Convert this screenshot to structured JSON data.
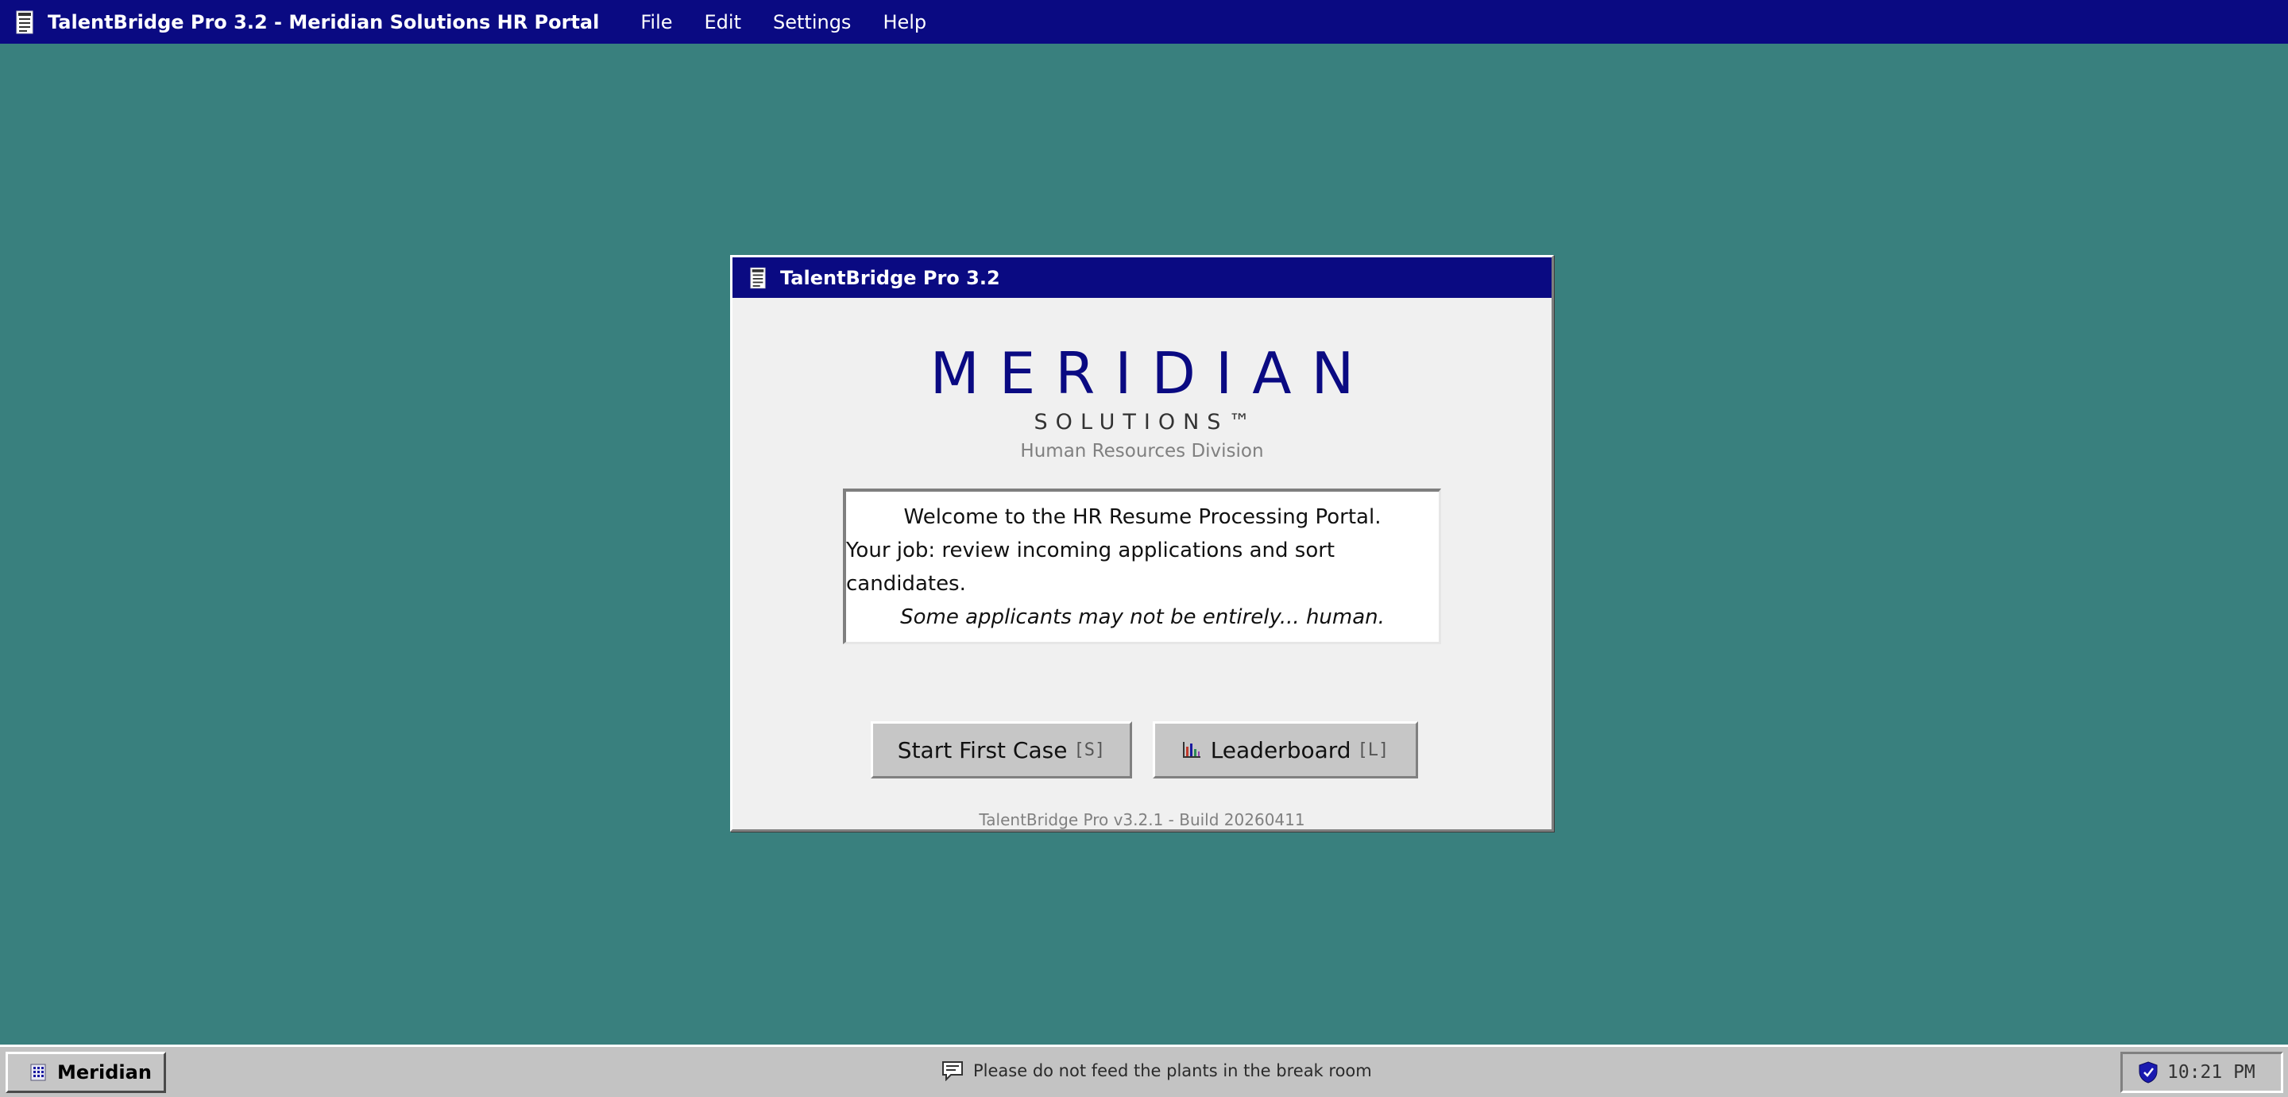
{
  "window": {
    "title": "TalentBridge Pro 3.2 - Meridian Solutions HR Portal",
    "menu": [
      "File",
      "Edit",
      "Settings",
      "Help"
    ]
  },
  "dialog": {
    "title": "TalentBridge Pro 3.2",
    "brand_name": "MERIDIAN",
    "brand_sub": "SOLUTIONS™",
    "division": "Human Resources Division",
    "message": {
      "line1": "Welcome to the HR Resume Processing Portal.",
      "line2": "Your job: review incoming applications and sort candidates.",
      "line3": "Some applicants may not be entirely... human."
    },
    "buttons": {
      "start_label": "Start First Case",
      "start_hotkey": "[S]",
      "leaderboard_label": "Leaderboard",
      "leaderboard_hotkey": "[L]"
    },
    "build_info": "TalentBridge Pro v3.2.1 - Build 20260411"
  },
  "taskbar": {
    "start_label": "Meridian",
    "ticker": "Please do not feed the plants in the break room",
    "clock": "10:21 PM"
  },
  "icons": {
    "app": "document-icon",
    "leaderboard": "bar-chart-icon",
    "start": "grid-icon",
    "ticker": "chat-bubble-icon",
    "tray": "shield-icon"
  },
  "colors": {
    "desktop": "#39807e",
    "titlebar": "#0a0a82",
    "dialog_bg": "#f0f0f0",
    "button_bg": "#c6c6c6",
    "taskbar_bg": "#c3c3c3"
  }
}
